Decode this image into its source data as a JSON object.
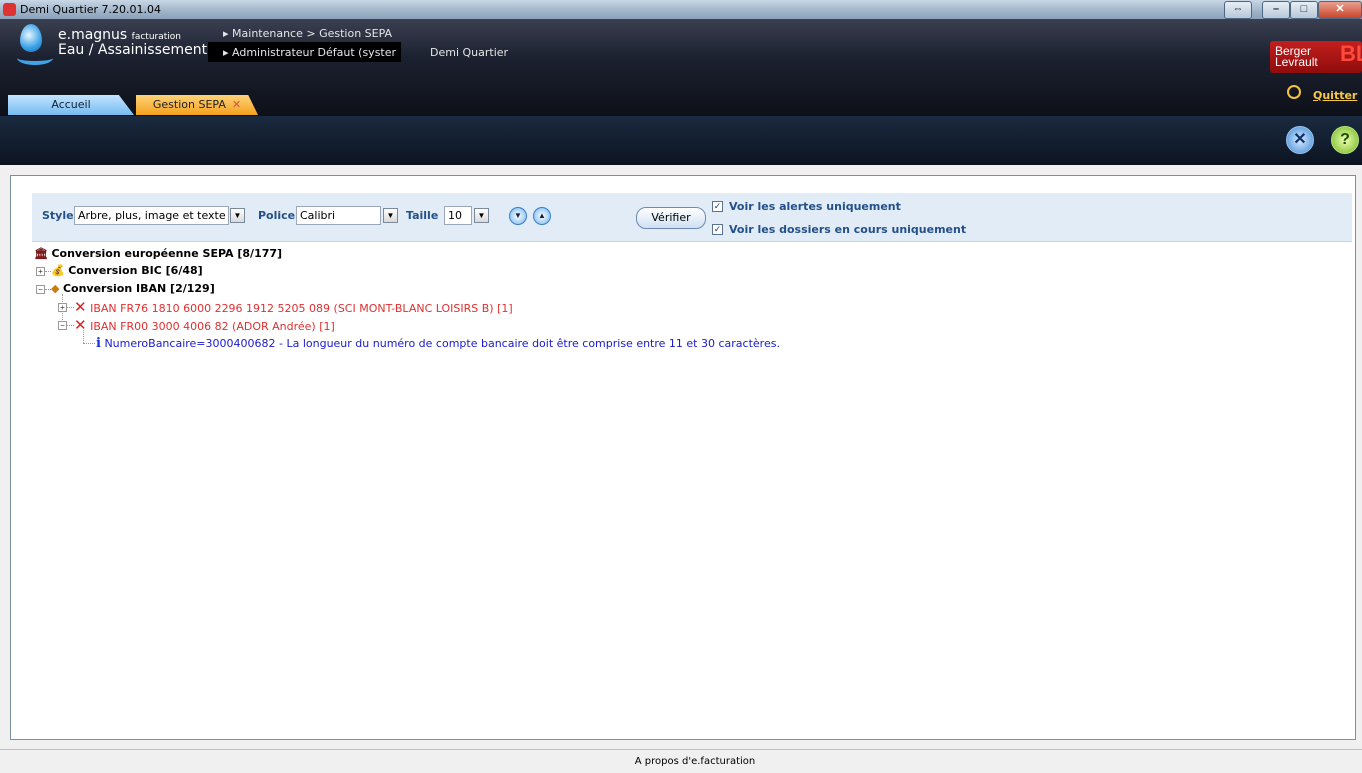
{
  "window": {
    "title": "Demi Quartier 7.20.01.04"
  },
  "header": {
    "brand_line1": "e.magnus",
    "brand_line1_small": "facturation",
    "brand_line2": "Eau / Assainissement",
    "breadcrumb": "Maintenance > Gestion SEPA",
    "user": "Administrateur Défaut (syster",
    "site": "Demi Quartier",
    "vendor_line1": "Berger",
    "vendor_line2": "Levrault",
    "quit_label": "Quitter"
  },
  "tabs": [
    {
      "label": "Accueil"
    },
    {
      "label": "Gestion SEPA",
      "close": "✕"
    }
  ],
  "options": {
    "style_label": "Style",
    "style_value": "Arbre, plus, image et texte",
    "police_label": "Police",
    "police_value": "Calibri",
    "taille_label": "Taille",
    "taille_value": "10",
    "verify_label": "Vérifier",
    "check_alerts_label": "Voir les alertes uniquement",
    "check_alerts_checked": true,
    "check_inprogress_label": "Voir les dossiers en cours uniquement",
    "check_inprogress_checked": true
  },
  "tree": {
    "root": "Conversion européenne SEPA [8/177]",
    "bic": "Conversion BIC [6/48]",
    "iban": "Conversion IBAN [2/129]",
    "iban_item1": "IBAN FR76 1810 6000 2296 1912 5205 089 (SCI MONT-BLANC LOISIRS B) [1]",
    "iban_item2": "IBAN FR00 3000 4006 82 (ADOR Andrée) [1]",
    "iban_item2_info": "NumeroBancaire=3000400682 - La longueur du numéro de compte bancaire doit être comprise entre 11 et 30 caractères."
  },
  "status": {
    "text": "A propos d'e.facturation"
  },
  "colors": {
    "error": "#e03030",
    "info": "#1a1ad0",
    "tab_active": "#f4a11c",
    "tab_home": "#75bbf0"
  }
}
